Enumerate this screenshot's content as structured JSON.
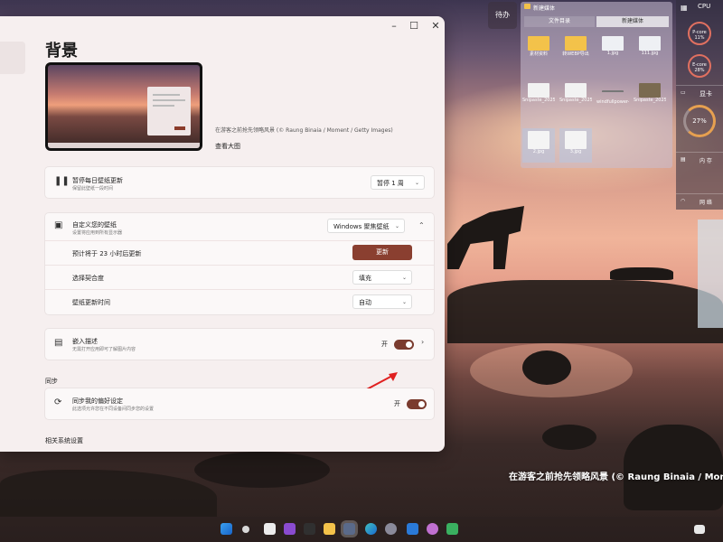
{
  "desktop": {
    "caption": "在游客之前抢先领略风景 (© Raung Binaia / Moment"
  },
  "window": {
    "title": "背景",
    "controls": {
      "minimize": "–",
      "maximize": "☐",
      "close": "✕"
    },
    "image_caption": "在游客之前抢先领略风景 (© Raung Binaia / Moment / Getty Images)",
    "view_large": "查看大图",
    "pause_card": {
      "title": "暂停每日壁纸更新",
      "desc": "保留此壁纸一段时间",
      "dropdown": "暂停 1 周"
    },
    "personalize_card": {
      "title": "自定义您的壁纸",
      "desc": "设置将应用到所有显示器",
      "dropdown": "Windows 聚焦壁纸",
      "rows": [
        {
          "label": "预计将于 23 小时后更新",
          "control": "更新"
        },
        {
          "label": "选择契合度",
          "control": "填充"
        },
        {
          "label": "壁纸更新时间",
          "control": "自动"
        }
      ]
    },
    "embed_card": {
      "title": "嵌入描述",
      "desc": "无需打开应用即可了解图片内容",
      "toggle_label": "开",
      "toggle_on": true
    },
    "sync_heading": "同步",
    "sync_card": {
      "title": "同步我的偏好设定",
      "desc": "此选项允许您在不同设备间同步您的设置",
      "toggle_label": "开",
      "toggle_on": true
    },
    "related_heading": "相关系统设置"
  },
  "time_widget": {
    "label": "待办"
  },
  "fences": {
    "header": "新建媒体",
    "tabs": [
      "文件目录",
      "新建媒体"
    ],
    "items": [
      {
        "label": "素材资料",
        "kind": "folder"
      },
      {
        "label": "转WEBP导出",
        "kind": "folder"
      },
      {
        "label": "1.jpg",
        "kind": "image"
      },
      {
        "label": "111.jpg",
        "kind": "image"
      },
      {
        "label": "Snipaste_2025-05-24_11...",
        "kind": "image"
      },
      {
        "label": "Snipaste_2025-05-24_11...",
        "kind": "image"
      },
      {
        "label": "windfullpower-logo.png",
        "kind": "image"
      },
      {
        "label": "Snipaste_2025-05-28_16...",
        "kind": "image"
      },
      {
        "label": "2.jpg",
        "kind": "image"
      },
      {
        "label": "3.jpg",
        "kind": "image"
      }
    ]
  },
  "sysmon": {
    "cpu_label": "CPU",
    "core1": "P-core 11%",
    "core2": "E-core 28%",
    "gpu_label": "显卡",
    "gpu_value": "27%",
    "mem_label": "内 存",
    "net_label": "网 络"
  },
  "colors": {
    "accent": "#8a3f30",
    "toggle": "#7a3b2e",
    "window_bg": "#f6efef"
  }
}
